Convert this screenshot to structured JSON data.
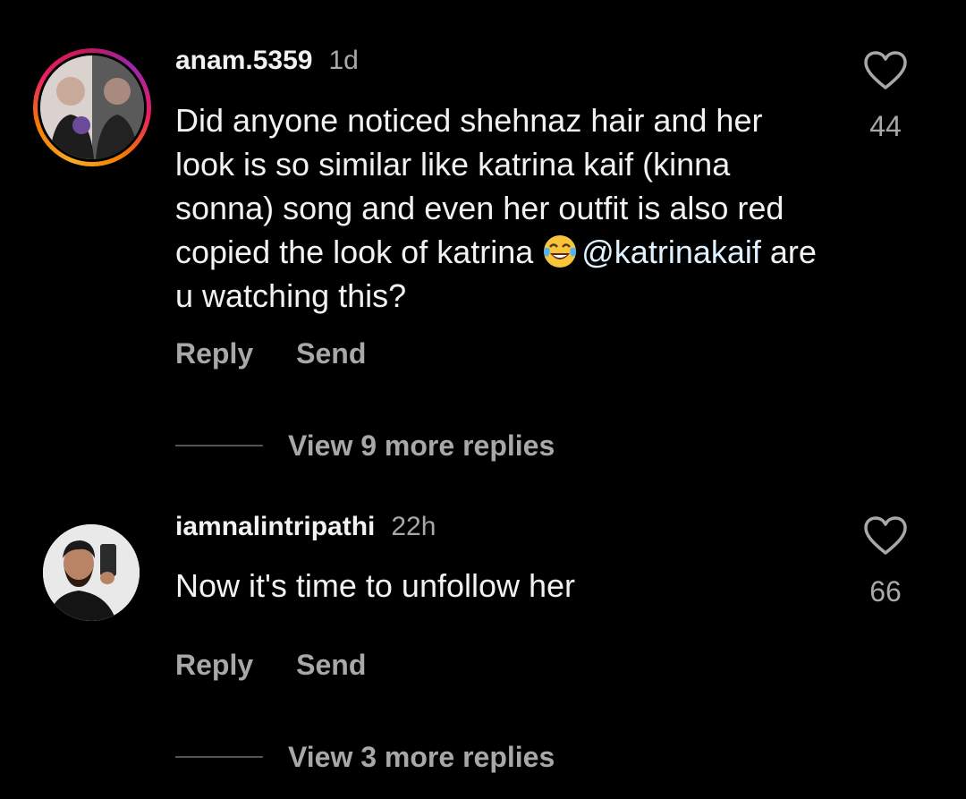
{
  "colors": {
    "background": "#000000",
    "primary_text": "#f2f2f2",
    "secondary_text": "#a8a8a8",
    "mention": "#e0f1ff",
    "story_ring": [
      "#f9a825",
      "#e91e63",
      "#9c27b0"
    ]
  },
  "comments": [
    {
      "username": "anam.5359",
      "time": "1d",
      "text_before_mention": "Did anyone noticed shehnaz hair and her look is so similar like katrina kaif (kinna sonna) song and even her outfit is also red copied the look of katrina ",
      "emoji": "face-with-tears-of-joy",
      "mention": "@katrinakaif",
      "text_after_mention": " are u watching this?",
      "reply_label": "Reply",
      "send_label": "Send",
      "view_replies_label": "View 9 more replies",
      "like_count": "44",
      "has_story_ring": true
    },
    {
      "username": "iamnalintripathi",
      "time": "22h",
      "text": "Now it's time to unfollow her",
      "reply_label": "Reply",
      "send_label": "Send",
      "view_replies_label": "View 3 more replies",
      "like_count": "66",
      "has_story_ring": false
    }
  ],
  "icons": {
    "like": "heart-outline-icon"
  }
}
